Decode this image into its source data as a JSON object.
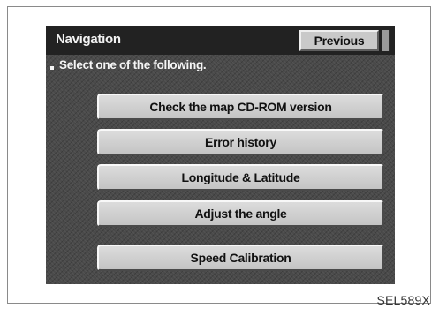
{
  "header": {
    "title": "Navigation",
    "previous_label": "Previous"
  },
  "instruction": "Select one of the following.",
  "menu": {
    "items": [
      {
        "label": "Check the map CD-ROM version"
      },
      {
        "label": "Error history"
      },
      {
        "label": "Longitude & Latitude"
      },
      {
        "label": "Adjust the angle"
      },
      {
        "label": "Speed Calibration"
      }
    ]
  },
  "figure_code": "SEL589X"
}
